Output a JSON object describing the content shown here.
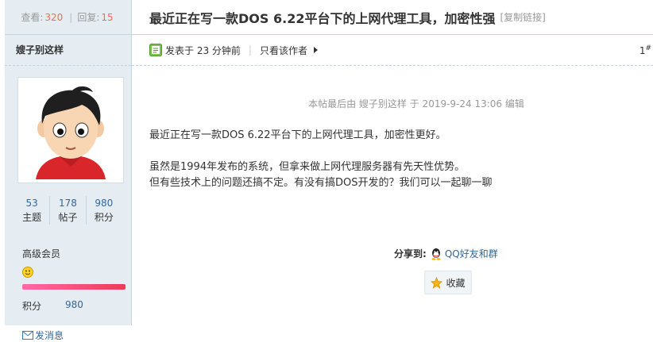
{
  "thread": {
    "views_label": "查看:",
    "views": "320",
    "replies_label": "回复:",
    "replies": "15",
    "title": "最近正在写一款DOS 6.22平台下的上网代理工具，加密性强",
    "copy_link": "[复制链接]"
  },
  "author": {
    "name": "嫂子别这样",
    "stats": [
      {
        "value": "53",
        "label": "主题"
      },
      {
        "value": "178",
        "label": "帖子"
      },
      {
        "value": "980",
        "label": "积分"
      }
    ],
    "member_level": "高级会员",
    "points_label": "积分",
    "points_value": "980",
    "send_message": "发消息"
  },
  "post": {
    "posted_at": "发表于 23 分钟前",
    "only_author": "只看该作者",
    "floor_number": "1",
    "floor_suffix": "#",
    "edit_note": "本帖最后由 嫂子别这样 于 2019-9-24 13:06 编辑",
    "body_line1": "最近正在写一款DOS 6.22平台下的上网代理工具，加密性更好。",
    "body_line2": "虽然是1994年发布的系统，但拿来做上网代理服务器有先天性优势。",
    "body_line3": "但有些技术上的问题还搞不定。有没有搞DOS开发的？我们可以一起聊一聊"
  },
  "share": {
    "label": "分享到:",
    "qq_label": "QQ好友和群",
    "favorite_label": "收藏"
  },
  "icons": [
    "smiley-icon",
    "mail-icon",
    "post-icon",
    "arrow-right-icon",
    "qq-icon",
    "star-icon"
  ],
  "colors": {
    "link": "#336699",
    "count_accent": "#f26c4f",
    "sidebar_bg": "#e5edf2"
  }
}
